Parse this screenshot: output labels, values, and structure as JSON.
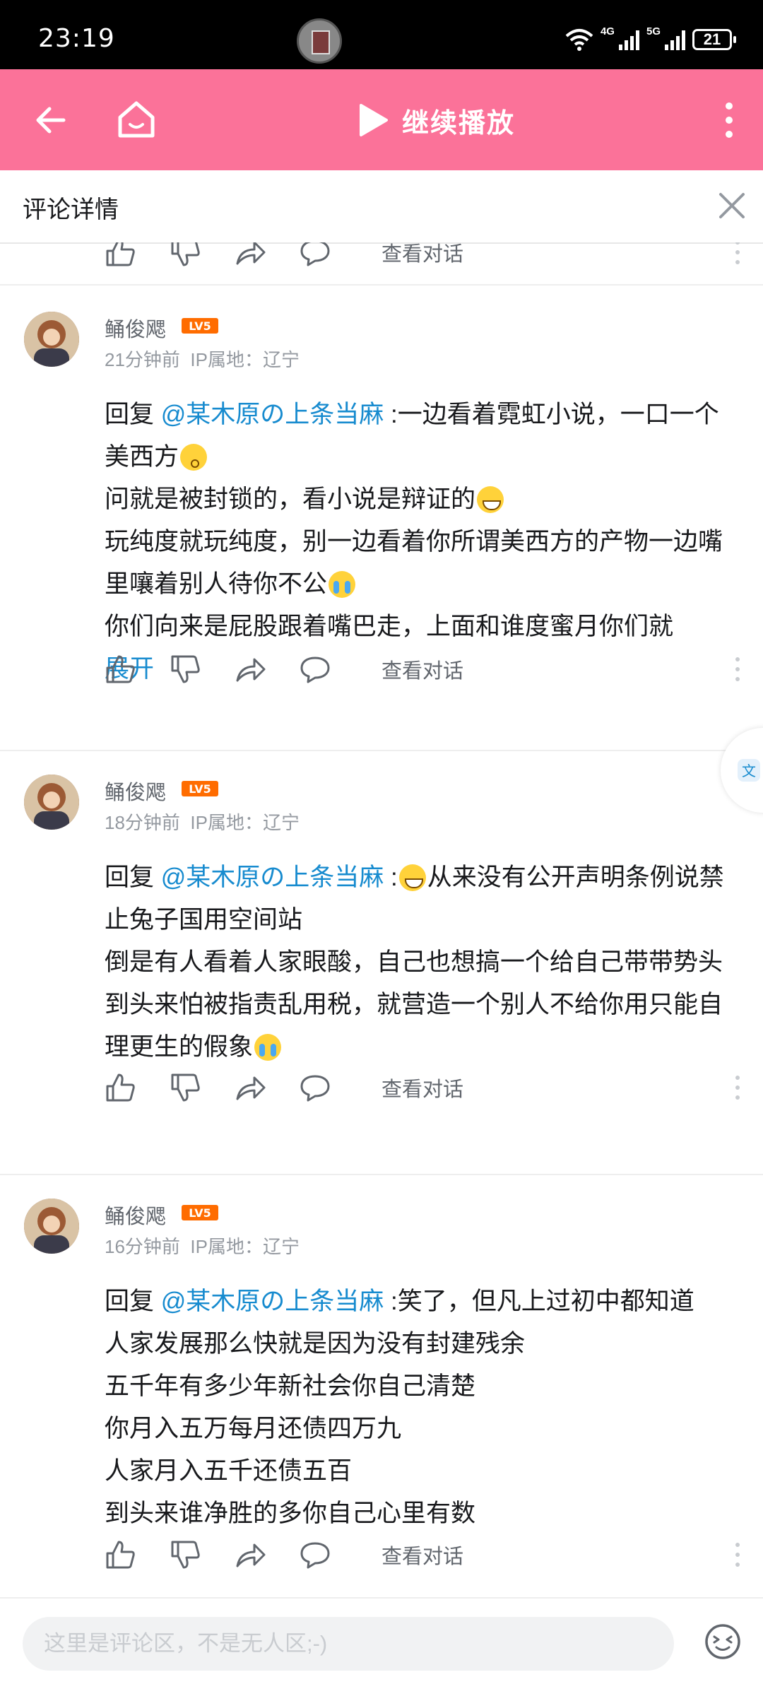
{
  "status_bar": {
    "time": "23:19",
    "network_1": "4G",
    "network_2": "5G",
    "battery": "21"
  },
  "top_bar": {
    "play_label": "继续播放",
    "accent_color": "#fb7299"
  },
  "subheader": {
    "title": "评论详情"
  },
  "action_labels": {
    "view_dialog": "查看对话"
  },
  "comments": [
    {
      "username": "鲬俊飔",
      "level": "LV5",
      "time": "21分钟前",
      "ip": "IP属地：辽宁",
      "reply_prefix": "回复 ",
      "mention": "@某木原の上条当麻",
      "lines": [
        " :一边看着霓虹小说，一口一个美西方",
        "问就是被封锁的，看小说是辩证的",
        "玩纯度就玩纯度，别一边看着你所谓美西方的产物一边嘴里嚷着别人待你不公",
        "你们向来是屁股跟着嘴巴走，上面和谁度蜜月你们就"
      ],
      "expand": "展开"
    },
    {
      "username": "鲬俊飔",
      "level": "LV5",
      "time": "18分钟前",
      "ip": "IP属地：辽宁",
      "reply_prefix": "回复 ",
      "mention": "@某木原の上条当麻",
      "lines": [
        " :",
        "从来没有公开声明条例说禁止兔子国用空间站",
        "倒是有人看着人家眼酸，自己也想搞一个给自己带带势头",
        "到头来怕被指责乱用税，就营造一个别人不给你用只能自理更生的假象"
      ]
    },
    {
      "username": "鲬俊飔",
      "level": "LV5",
      "time": "16分钟前",
      "ip": "IP属地：辽宁",
      "reply_prefix": "回复 ",
      "mention": "@某木原の上条当麻",
      "lines": [
        " :笑了，但凡上过初中都知道",
        "人家发展那么快就是因为没有封建残余",
        "五千年有多少年新社会你自己清楚",
        "你月入五万每月还债四万九",
        "人家月入五千还债五百",
        "到头来谁净胜的多你自己心里有数"
      ]
    }
  ],
  "input_bar": {
    "placeholder": "这里是评论区，不是无人区;-)"
  }
}
